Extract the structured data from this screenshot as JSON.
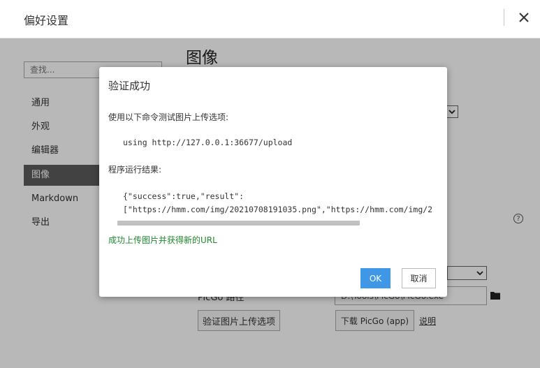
{
  "window": {
    "title": "偏好设置"
  },
  "sidebar": {
    "search_placeholder": "查找...",
    "items": [
      {
        "label": "通用"
      },
      {
        "label": "外观"
      },
      {
        "label": "编辑器"
      },
      {
        "label": "图像",
        "active": true
      },
      {
        "label": "Markdown"
      },
      {
        "label": "导出"
      }
    ]
  },
  "main": {
    "title": "图像",
    "picgo_label": "PicGo 路径",
    "picgo_path": "D:\\Tools\\PicGo\\PicGo.exe",
    "verify_button": "验证图片上传选项",
    "download_button": "下载 PicGo (app)",
    "explain_link": "说明",
    "help_icon": "?"
  },
  "dialog": {
    "title": "验证成功",
    "intro": "使用以下命令测试图片上传选项:",
    "command": "using http://127.0.0.1:36677/upload",
    "result_label": "程序运行结果:",
    "result_line1": "{\"success\":true,\"result\":",
    "result_line2": "[\"https://hmm.com/img/20210708191035.png\",\"https://hmm.com/img/2",
    "success_message": "成功上传图片并获得新的URL",
    "ok_label": "OK",
    "cancel_label": "取消"
  },
  "colors": {
    "ok_button": "#3f97e8",
    "success_text": "#1e8a2f",
    "active_nav": "#5c5c5c"
  },
  "icons": {
    "close": "close-icon",
    "folder": "folder-icon",
    "help": "help-icon",
    "dropdown": "chevron-down-icon"
  }
}
